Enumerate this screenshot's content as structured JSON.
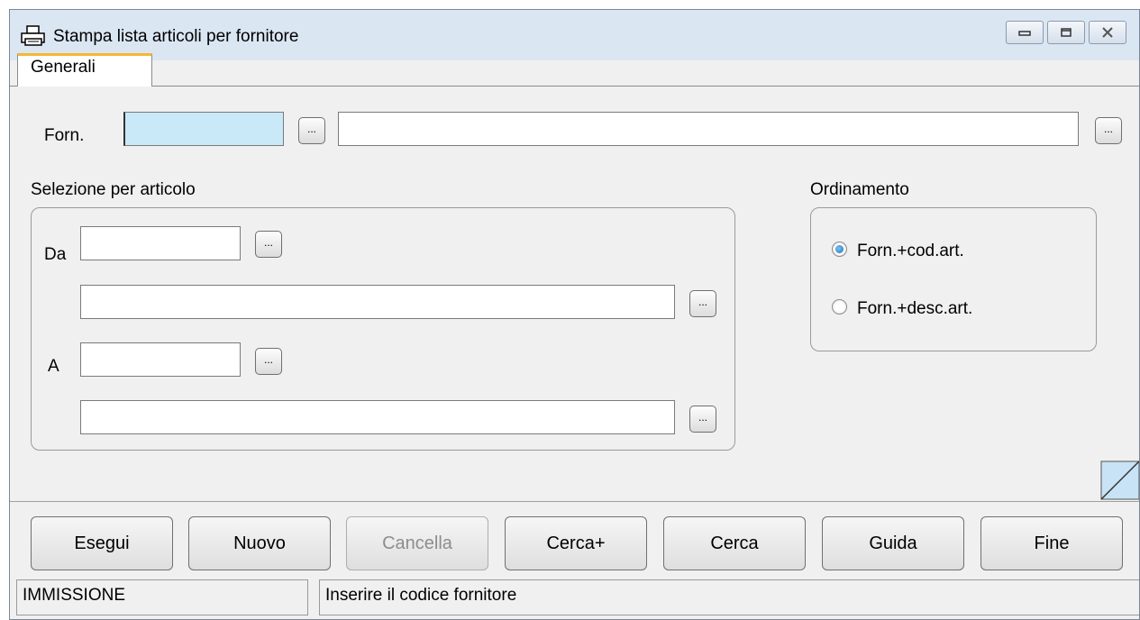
{
  "window": {
    "title": "Stampa lista articoli per fornitore",
    "icon": "printer-icon"
  },
  "tabs": [
    {
      "label": "Generali"
    }
  ],
  "forn": {
    "label": "Forn.",
    "code_value": "",
    "desc_value": ""
  },
  "selezione": {
    "title": "Selezione per articolo",
    "da_label": "Da",
    "a_label": "A",
    "da_code": "",
    "da_desc": "",
    "a_code": "",
    "a_desc": ""
  },
  "ordinamento": {
    "title": "Ordinamento",
    "options": [
      {
        "label": "Forn.+cod.art.",
        "selected": true
      },
      {
        "label": "Forn.+desc.art.",
        "selected": false
      }
    ]
  },
  "lookup_label": "...",
  "buttons": {
    "esegui": "Esegui",
    "nuovo": "Nuovo",
    "cancella": "Cancella",
    "cerca_plus": "Cerca+",
    "cerca": "Cerca",
    "guida": "Guida",
    "fine": "Fine"
  },
  "status": {
    "mode": "IMMISSIONE",
    "message": "Inserire il codice fornitore"
  }
}
